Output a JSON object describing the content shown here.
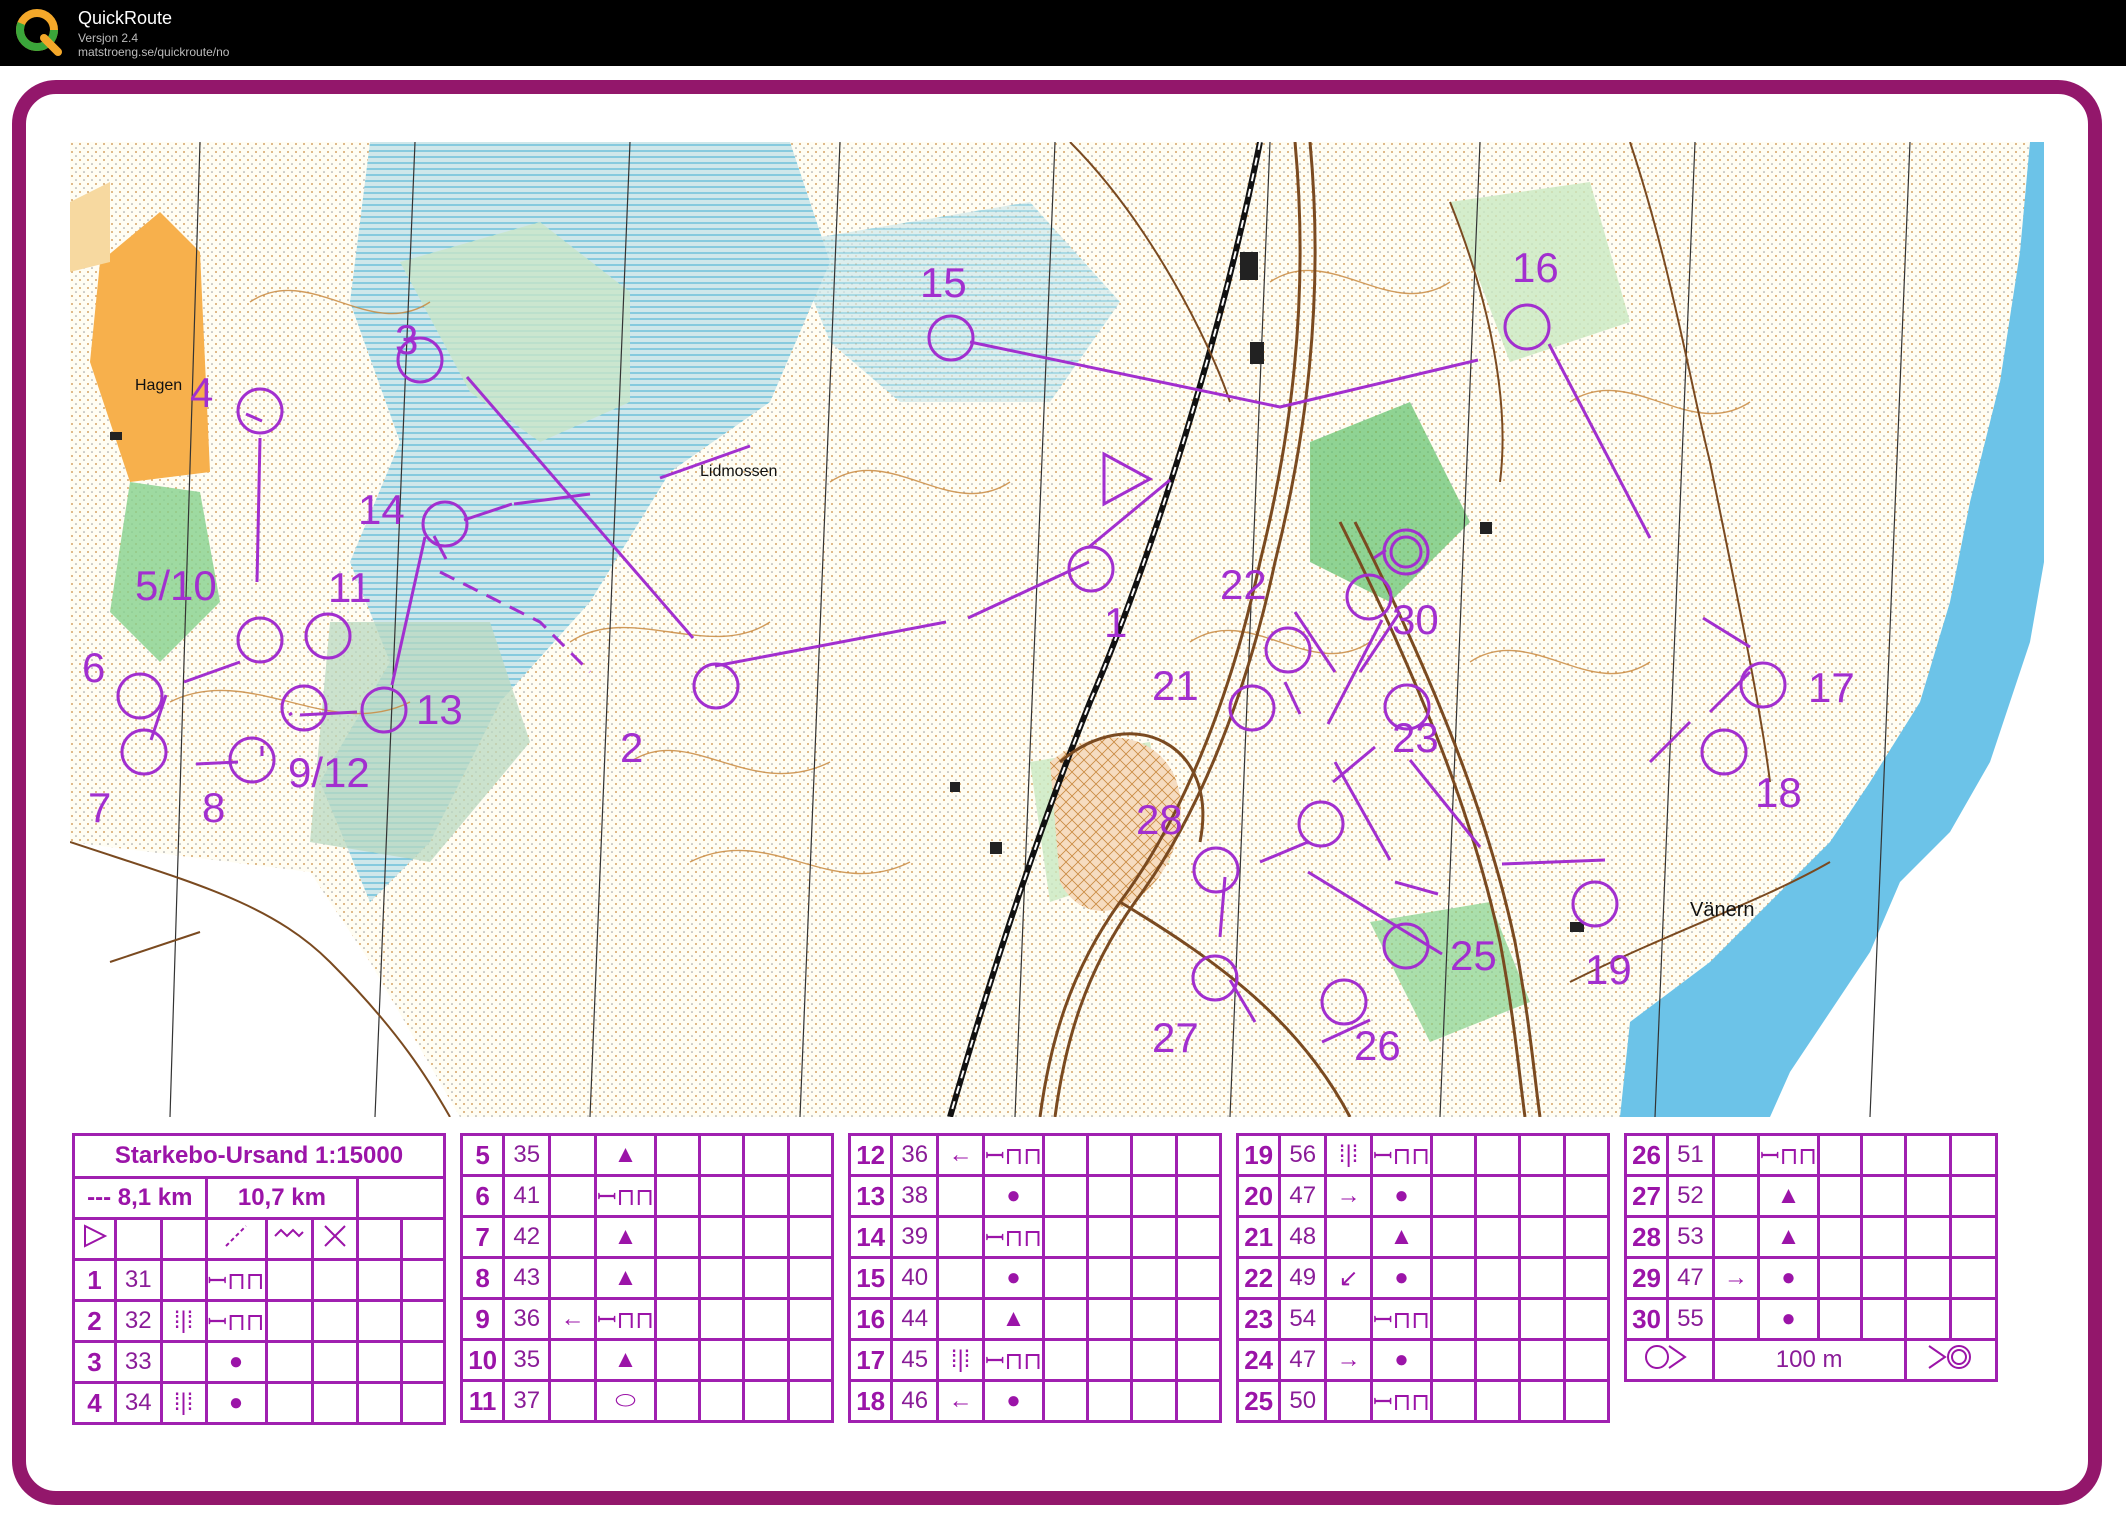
{
  "app": {
    "title": "QuickRoute",
    "version": "Versjon 2.4",
    "url": "matstroeng.se/quickroute/no",
    "logo_letter": "Q"
  },
  "map": {
    "place_names": {
      "hagen": "Hagen",
      "lidmossen": "Lidmossen",
      "vanern": "Vänern"
    },
    "control_labels": [
      "1",
      "2",
      "3",
      "4",
      "5/10",
      "6",
      "7",
      "8",
      "9/12",
      "11",
      "13",
      "14",
      "15",
      "16",
      "17",
      "18",
      "19",
      "21",
      "22",
      "23",
      "25",
      "26",
      "27",
      "28",
      "30"
    ],
    "course_color": "#a22fcf",
    "water_color": "#6cc3e8",
    "open_color": "#f7b04c",
    "forest_green": "#60c06a"
  },
  "legend": {
    "title": "Starkebo-Ursand 1:15000",
    "dist1": "--- 8,1 km",
    "dist2": "10,7 km",
    "scale_text": "100 m",
    "rows_block1": [
      {
        "n": "1",
        "c": "31",
        "d": "",
        "e": "ꟷ⊓⊓"
      },
      {
        "n": "2",
        "c": "32",
        "d": "⁞|⁞",
        "e": "ꟷ⊓⊓"
      },
      {
        "n": "3",
        "c": "33",
        "d": "",
        "e": "●"
      },
      {
        "n": "4",
        "c": "34",
        "d": "⁞|⁞",
        "e": "●"
      }
    ],
    "rows_block2": [
      {
        "n": "5",
        "c": "35",
        "d": "",
        "e": "▲"
      },
      {
        "n": "6",
        "c": "41",
        "d": "",
        "e": "ꟷ⊓⊓"
      },
      {
        "n": "7",
        "c": "42",
        "d": "",
        "e": "▲"
      },
      {
        "n": "8",
        "c": "43",
        "d": "",
        "e": "▲"
      },
      {
        "n": "9",
        "c": "36",
        "d": "←",
        "e": "ꟷ⊓⊓"
      },
      {
        "n": "10",
        "c": "35",
        "d": "",
        "e": "▲"
      },
      {
        "n": "11",
        "c": "37",
        "d": "",
        "e": "⬭"
      }
    ],
    "rows_block3": [
      {
        "n": "12",
        "c": "36",
        "d": "←",
        "e": "ꟷ⊓⊓"
      },
      {
        "n": "13",
        "c": "38",
        "d": "",
        "e": "●"
      },
      {
        "n": "14",
        "c": "39",
        "d": "",
        "e": "ꟷ⊓⊓"
      },
      {
        "n": "15",
        "c": "40",
        "d": "",
        "e": "●"
      },
      {
        "n": "16",
        "c": "44",
        "d": "",
        "e": "▲"
      },
      {
        "n": "17",
        "c": "45",
        "d": "⁞|⁞",
        "e": "ꟷ⊓⊓"
      },
      {
        "n": "18",
        "c": "46",
        "d": "←",
        "e": "●"
      }
    ],
    "rows_block4": [
      {
        "n": "19",
        "c": "56",
        "d": "⁞|⁞",
        "e": "ꟷ⊓⊓"
      },
      {
        "n": "20",
        "c": "47",
        "d": "→",
        "e": "●"
      },
      {
        "n": "21",
        "c": "48",
        "d": "",
        "e": "▲"
      },
      {
        "n": "22",
        "c": "49",
        "d": "↙",
        "e": "●"
      },
      {
        "n": "23",
        "c": "54",
        "d": "",
        "e": "ꟷ⊓⊓"
      },
      {
        "n": "24",
        "c": "47",
        "d": "→",
        "e": "●"
      },
      {
        "n": "25",
        "c": "50",
        "d": "",
        "e": "ꟷ⊓⊓"
      }
    ],
    "rows_block5": [
      {
        "n": "26",
        "c": "51",
        "d": "",
        "e": "ꟷ⊓⊓"
      },
      {
        "n": "27",
        "c": "52",
        "d": "",
        "e": "▲"
      },
      {
        "n": "28",
        "c": "53",
        "d": "",
        "e": "▲"
      },
      {
        "n": "29",
        "c": "47",
        "d": "→",
        "e": "●"
      },
      {
        "n": "30",
        "c": "55",
        "d": "",
        "e": "●"
      }
    ]
  }
}
